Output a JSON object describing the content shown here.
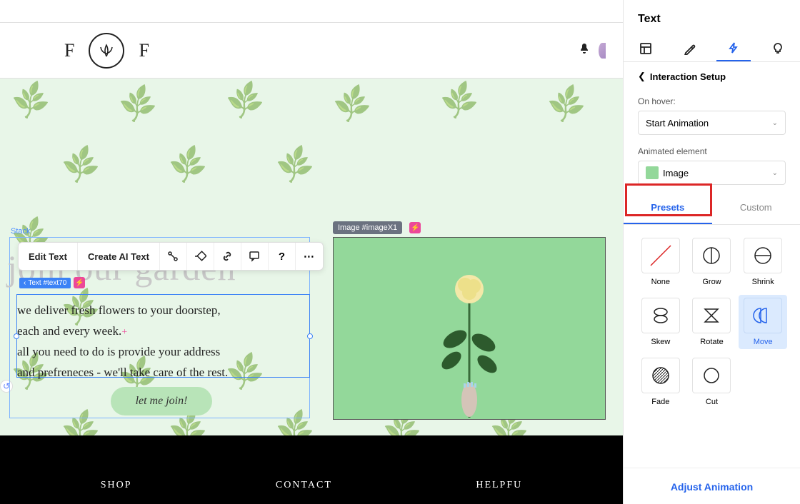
{
  "header": {
    "logo_left": "F",
    "logo_right": "F"
  },
  "canvas": {
    "stack_label": "Stack",
    "heading": "join our garden",
    "toolbar": {
      "edit_text": "Edit Text",
      "create_ai_text": "Create AI Text"
    },
    "text_tag": "Text #text70",
    "body_line1": "we deliver fresh flowers to your doorstep,",
    "body_line2": "each and every week.",
    "body_line3": "all you need to do is provide your address",
    "body_line4": "and prefreneces - we'll take care of the rest.",
    "cta": "let me join!",
    "image_tag": "Image #imageX1"
  },
  "footer": {
    "shop": "SHOP",
    "contact": "CONTACT",
    "helpful": "HELPFU"
  },
  "panel": {
    "title": "Text",
    "back_label": "Interaction Setup",
    "on_hover_label": "On hover:",
    "on_hover_value": "Start Animation",
    "animated_element_label": "Animated element",
    "animated_element_value": "Image",
    "sub_tabs": {
      "presets": "Presets",
      "custom": "Custom"
    },
    "presets": {
      "none": "None",
      "grow": "Grow",
      "shrink": "Shrink",
      "skew": "Skew",
      "rotate": "Rotate",
      "move": "Move",
      "fade": "Fade",
      "cut": "Cut"
    },
    "adjust": "Adjust Animation"
  }
}
